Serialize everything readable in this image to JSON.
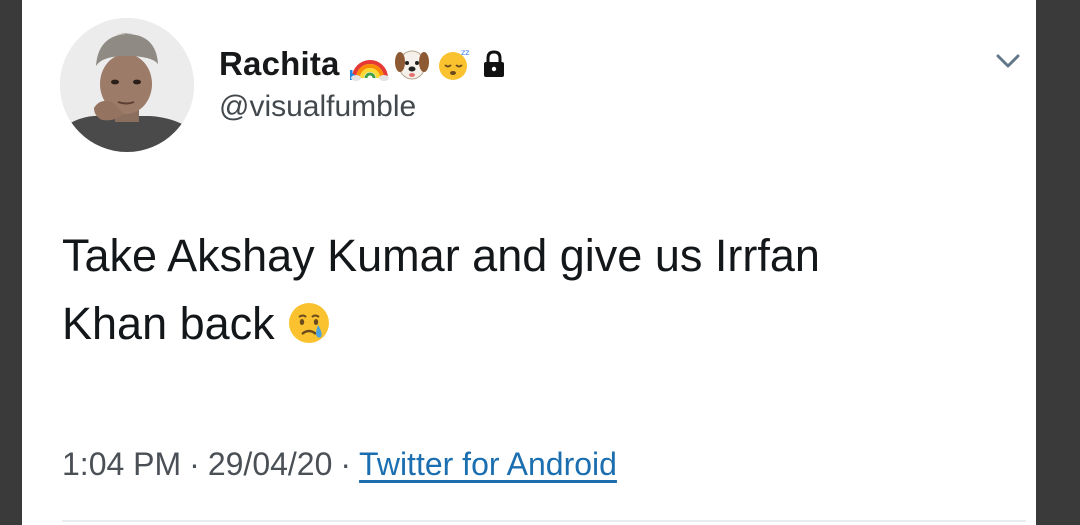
{
  "user": {
    "display_name": "Rachita",
    "handle": "@visualfumble",
    "badges": [
      "rainbow-emoji",
      "dog-face-emoji",
      "sleepy-face-emoji",
      "lock-icon"
    ],
    "avatar": "profile-photo"
  },
  "tweet": {
    "text_line_1": "Take Akshay Kumar and give us Irrfan",
    "text_line_2": "Khan back",
    "emoji": "crying-face-emoji"
  },
  "meta": {
    "time": "1:04 PM",
    "separator": "·",
    "date": "29/04/20",
    "source": "Twitter for Android"
  },
  "colors": {
    "background": "#ffffff",
    "text": "#14171a",
    "secondary_text": "#43484d",
    "link": "#1b6fb0",
    "outer_background": "#3a3a3a"
  },
  "icons": {
    "menu": "chevron-down-icon"
  }
}
